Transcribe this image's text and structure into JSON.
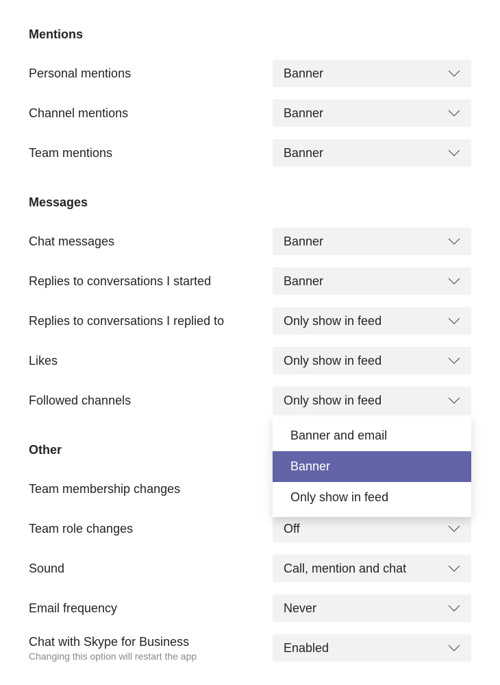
{
  "sections": {
    "mentions": {
      "header": "Mentions",
      "rows": {
        "personal": {
          "label": "Personal mentions",
          "value": "Banner"
        },
        "channel": {
          "label": "Channel mentions",
          "value": "Banner"
        },
        "team": {
          "label": "Team mentions",
          "value": "Banner"
        }
      }
    },
    "messages": {
      "header": "Messages",
      "rows": {
        "chat": {
          "label": "Chat messages",
          "value": "Banner"
        },
        "replies_started": {
          "label": "Replies to conversations I started",
          "value": "Banner"
        },
        "replies_replied": {
          "label": "Replies to conversations I replied to",
          "value": "Only show in feed"
        },
        "likes": {
          "label": "Likes",
          "value": "Only show in feed"
        },
        "followed": {
          "label": "Followed channels",
          "value": "Only show in feed"
        }
      }
    },
    "other": {
      "header": "Other",
      "rows": {
        "membership": {
          "label": "Team membership changes",
          "value": ""
        },
        "role": {
          "label": "Team role changes",
          "value": "Off"
        },
        "sound": {
          "label": "Sound",
          "value": "Call, mention and chat"
        },
        "email": {
          "label": "Email frequency",
          "value": "Never"
        },
        "skype": {
          "label": "Chat with Skype for Business",
          "helper": "Changing this option will restart the app",
          "value": "Enabled"
        }
      }
    }
  },
  "menu": {
    "opt0": "Banner and email",
    "opt1": "Banner",
    "opt2": "Only show in feed"
  }
}
